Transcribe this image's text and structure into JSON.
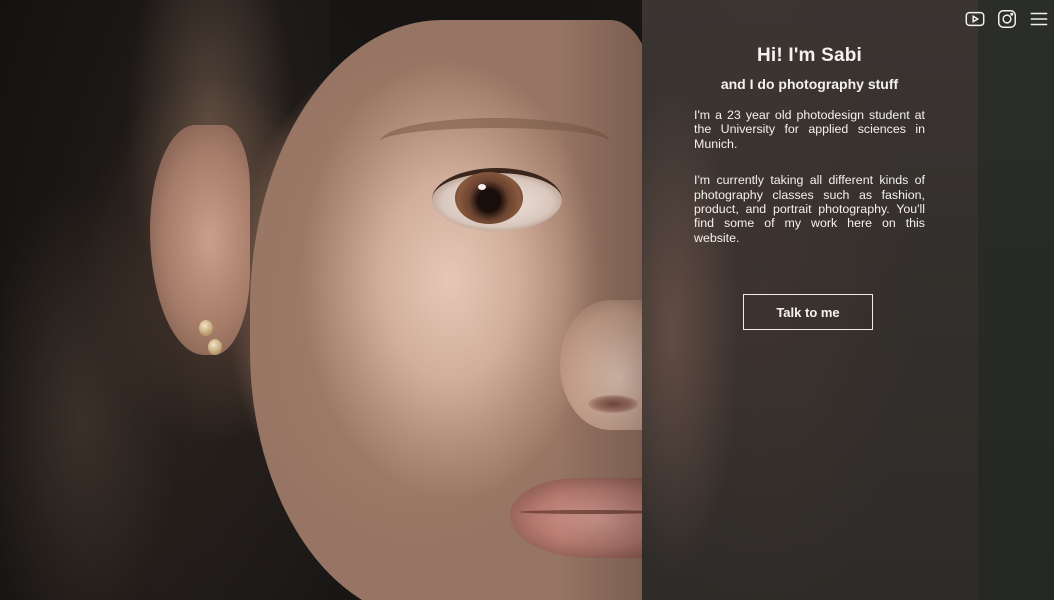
{
  "header": {
    "icons": [
      {
        "name": "youtube-icon"
      },
      {
        "name": "instagram-icon"
      },
      {
        "name": "menu-icon"
      }
    ]
  },
  "hero": {
    "title": "Hi! I'm Sabi",
    "subtitle": "and I do photography stuff",
    "paragraphs": [
      "I'm a 23 year old photodesign student at the University for applied sciences in Munich.",
      "I'm currently taking all different kinds of photography classes such as fashion, product, and portrait photography. You'll find some of my work here on this website."
    ],
    "cta_label": "Talk to me"
  },
  "colors": {
    "text": "#f4f1ee",
    "panel": "#35302d",
    "button_border": "#f1ece8"
  }
}
